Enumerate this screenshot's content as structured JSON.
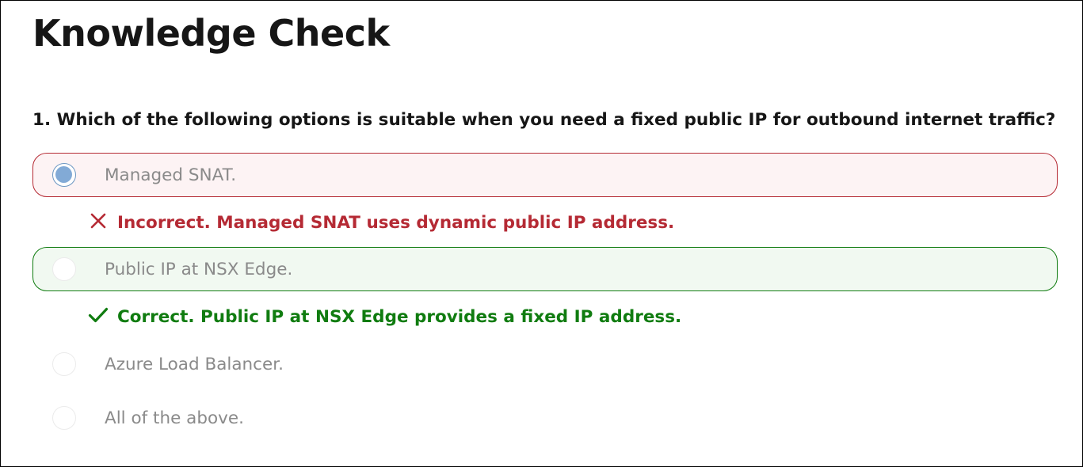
{
  "page": {
    "title": "Knowledge Check"
  },
  "question": {
    "text": "1. Which of the following options is suitable when you need a fixed public IP for outbound internet traffic?",
    "options": [
      {
        "label": "Managed SNAT.",
        "selected": true,
        "state": "incorrect",
        "feedback": "Incorrect. Managed SNAT uses dynamic public IP address.",
        "feedback_icon": "close-icon"
      },
      {
        "label": "Public IP at NSX Edge.",
        "selected": false,
        "state": "correct",
        "feedback": "Correct. Public IP at NSX Edge provides a fixed IP address.",
        "feedback_icon": "checkmark-icon"
      },
      {
        "label": "Azure Load Balancer.",
        "selected": false,
        "state": "neutral"
      },
      {
        "label": "All of the above.",
        "selected": false,
        "state": "neutral"
      }
    ]
  },
  "colors": {
    "incorrect": "#b52a34",
    "incorrect_bg": "#fdf3f4",
    "correct": "#107c10",
    "correct_bg": "#f1f9f1",
    "radio_selected": "#82aad6",
    "option_text": "#8a8a8a",
    "text": "#161616"
  }
}
